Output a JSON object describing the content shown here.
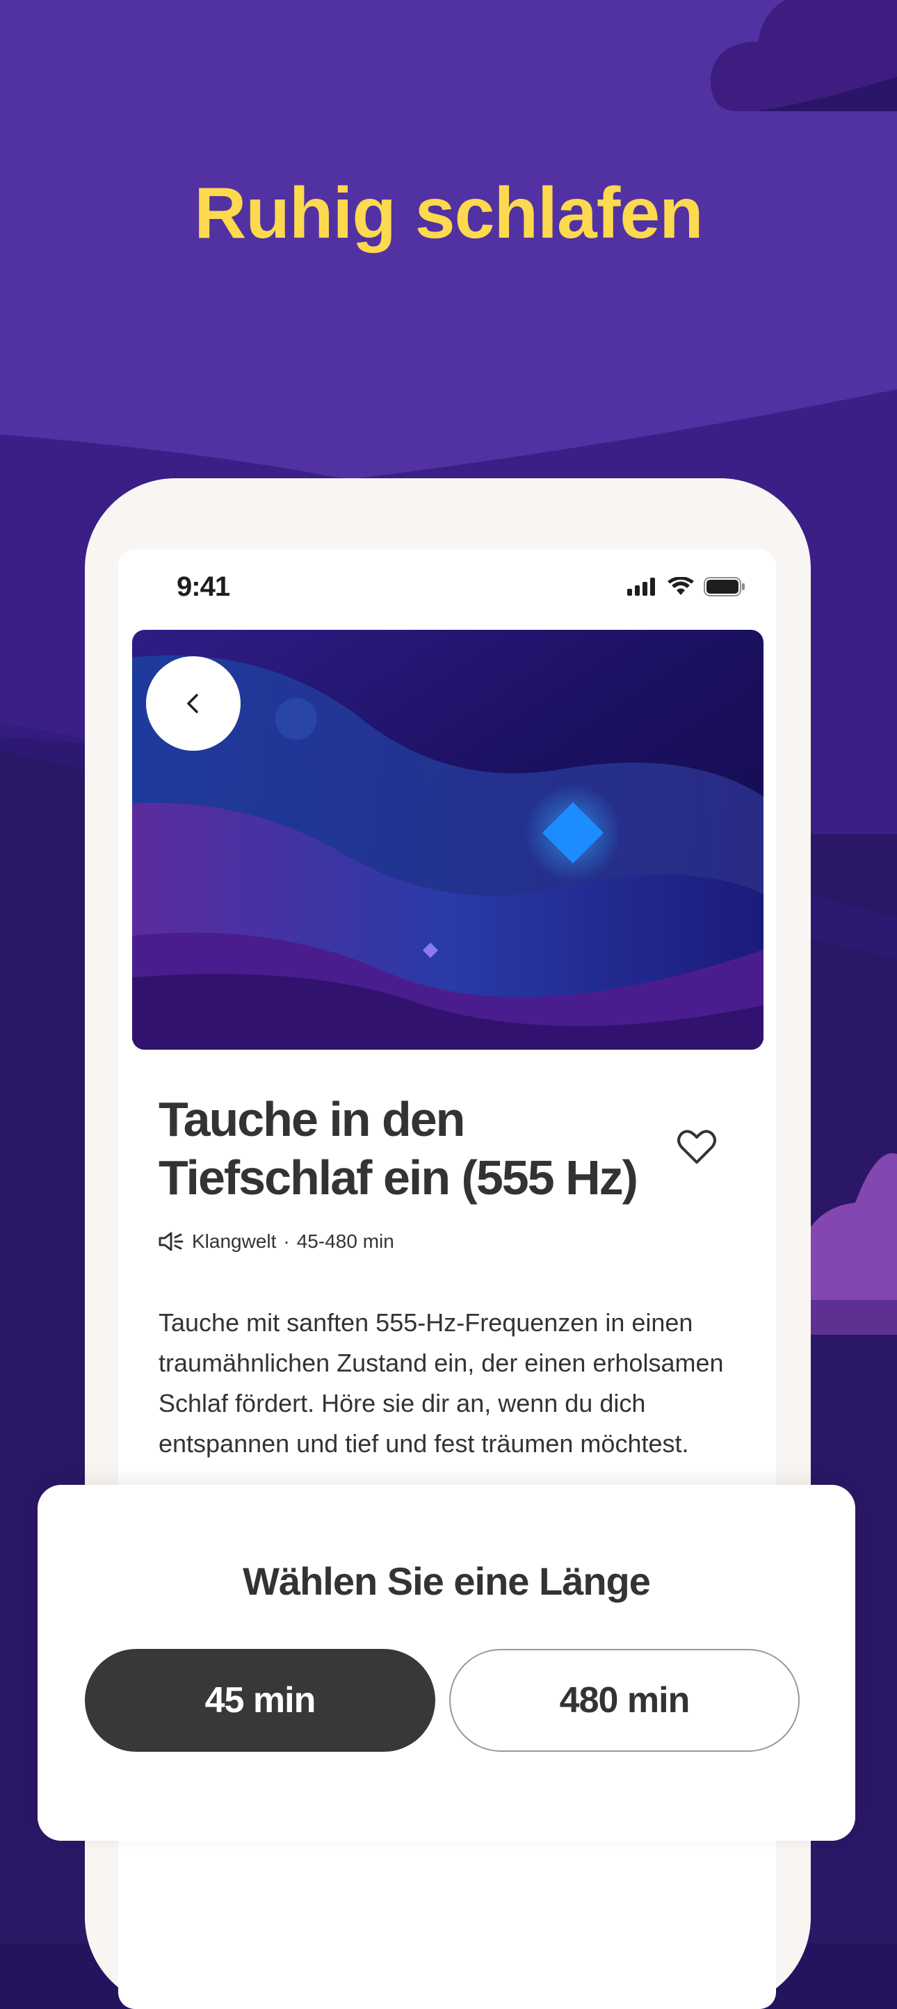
{
  "headline": "Ruhig schlafen",
  "status_bar": {
    "time": "9:41"
  },
  "session": {
    "title_line1": "Tauche in den",
    "title_line2": "Tiefschlaf ein (555 Hz)",
    "type": "Klangwelt",
    "duration_range": "45-480 min",
    "meta_separator": "·",
    "description": "Tauche mit sanften 555-Hz-Frequenzen in einen traumähnlichen Zustand ein, der einen erholsamen Schlaf fördert. Höre sie dir an, wenn du dich entspannen und tief und fest träumen möchtest."
  },
  "length_sheet": {
    "title": "Wählen Sie eine Länge",
    "options": [
      {
        "label": "45 min",
        "selected": true
      },
      {
        "label": "480 min",
        "selected": false
      }
    ]
  },
  "colors": {
    "accent_yellow": "#fcd94e",
    "background_purple": "#5231a3",
    "selected_button": "#3a3836"
  },
  "icons": [
    "back-chevron-icon",
    "heart-icon",
    "speaker-icon",
    "signal-icon",
    "wifi-icon",
    "battery-icon"
  ]
}
